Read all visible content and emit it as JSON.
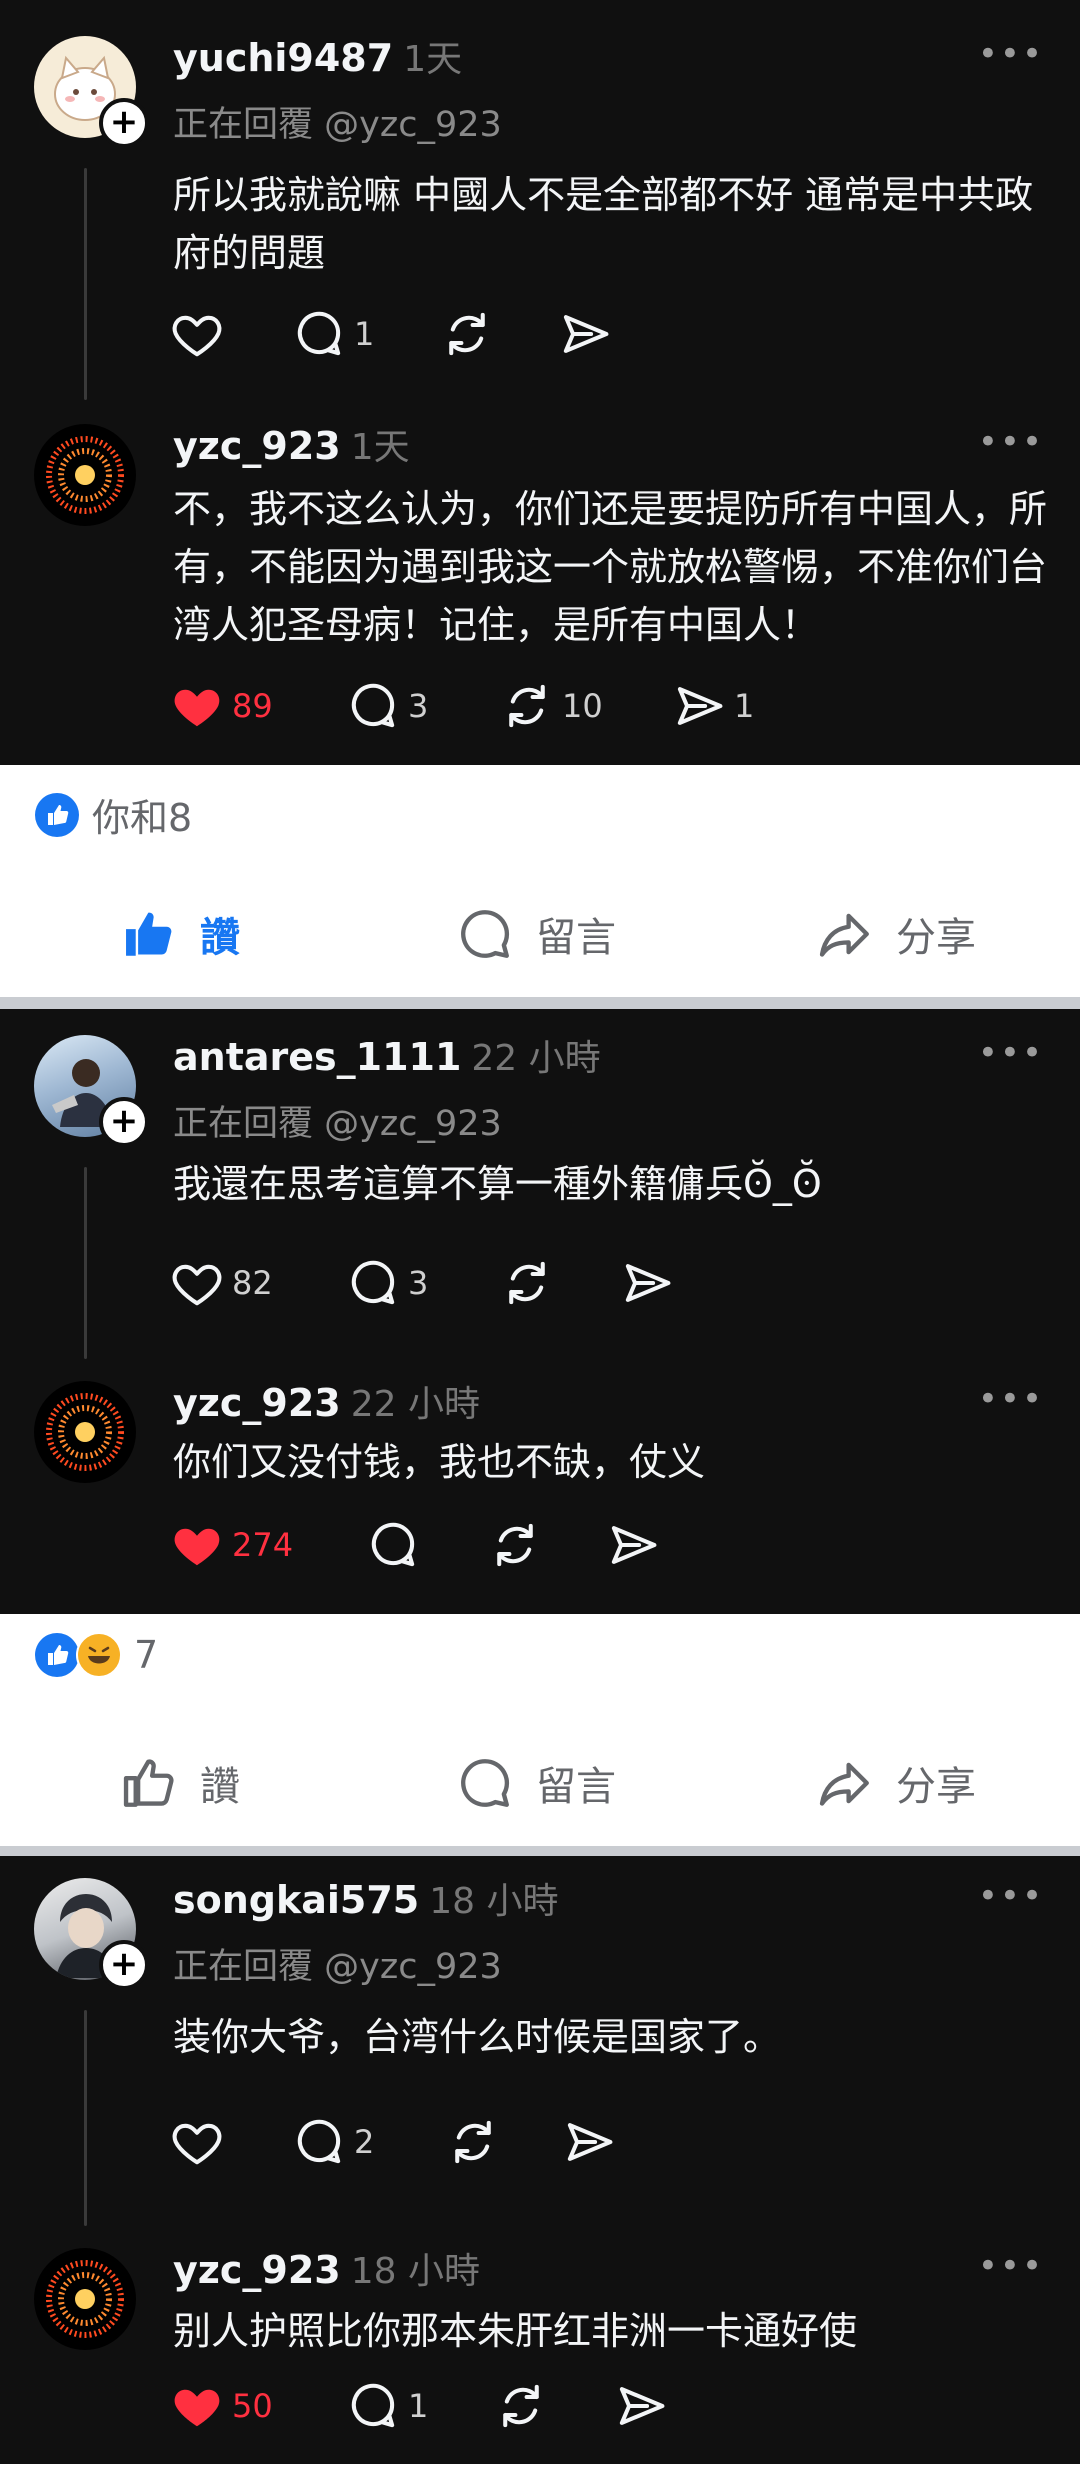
{
  "thread1": {
    "reply": {
      "username": "yuchi9487",
      "time": "1天",
      "replying_to": "正在回覆 @yzc_923",
      "text": "所以我就說嘛 中國人不是全部都不好 通常是中共政府的問題",
      "comments": "1"
    },
    "response": {
      "username": "yzc_923",
      "time": "1天",
      "text": "不，我不这么认为，你们还是要提防所有中国人，所有，不能因为遇到我这一个就放松警惕，不准你们台湾人犯圣母病！记住，是所有中国人！",
      "likes": "89",
      "comments": "3",
      "reposts": "10",
      "shares": "1"
    }
  },
  "fb1": {
    "reactions": "你和8",
    "like": "讚",
    "comment": "留言",
    "share": "分享"
  },
  "thread2": {
    "reply": {
      "username": "antares_1111",
      "time": "22 小時",
      "replying_to": "正在回覆 @yzc_923",
      "text": "我還在思考這算不算一種外籍傭兵ʘ̆_ʘ̆",
      "likes": "82",
      "comments": "3"
    },
    "response": {
      "username": "yzc_923",
      "time": "22 小時",
      "text": "你们又没付钱，我也不缺，仗义",
      "likes": "274"
    }
  },
  "fb2": {
    "reactions": "7",
    "like": "讚",
    "comment": "留言",
    "share": "分享"
  },
  "thread3": {
    "reply": {
      "username": "songkai575",
      "time": "18 小時",
      "replying_to": "正在回覆 @yzc_923",
      "text": "装你大爷，台湾什么时候是国家了。",
      "comments": "2"
    },
    "response": {
      "username": "yzc_923",
      "time": "18 小時",
      "text": "别人护照比你那本朱肝红非洲一卡通好使",
      "likes": "50",
      "comments": "1"
    }
  },
  "icons": {
    "more": "•••",
    "plus": "+",
    "like_color": "#ff3040",
    "fb_blue": "#1877f2"
  }
}
